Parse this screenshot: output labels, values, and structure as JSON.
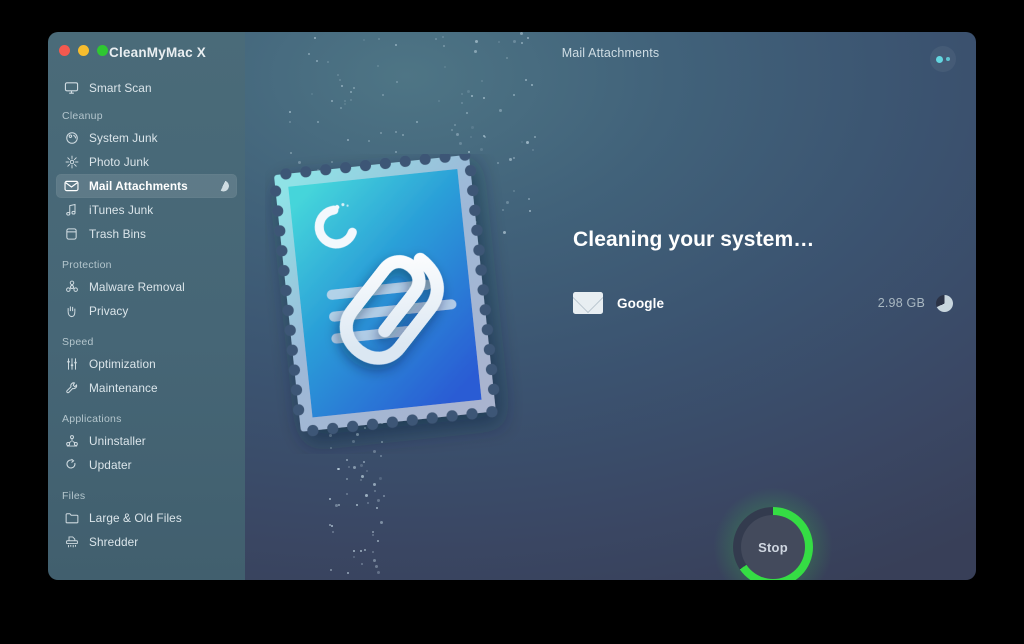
{
  "window": {
    "app_title": "CleanMyMac X",
    "window_title": "Mail Attachments",
    "traffic_lights": [
      "close",
      "minimize",
      "zoom"
    ]
  },
  "sidebar": {
    "top_items": [
      {
        "label": "Smart Scan",
        "icon": "smart-scan-icon"
      }
    ],
    "groups": [
      {
        "label": "Cleanup",
        "items": [
          {
            "label": "System Junk",
            "icon": "system-junk-icon",
            "selected": false
          },
          {
            "label": "Photo Junk",
            "icon": "photo-junk-icon",
            "selected": false
          },
          {
            "label": "Mail Attachments",
            "icon": "mail-icon",
            "selected": true,
            "busy": true
          },
          {
            "label": "iTunes Junk",
            "icon": "music-note-icon",
            "selected": false
          },
          {
            "label": "Trash Bins",
            "icon": "trash-bin-icon",
            "selected": false
          }
        ]
      },
      {
        "label": "Protection",
        "items": [
          {
            "label": "Malware Removal",
            "icon": "biohazard-icon",
            "selected": false
          },
          {
            "label": "Privacy",
            "icon": "hand-icon",
            "selected": false
          }
        ]
      },
      {
        "label": "Speed",
        "items": [
          {
            "label": "Optimization",
            "icon": "sliders-icon",
            "selected": false
          },
          {
            "label": "Maintenance",
            "icon": "wrench-icon",
            "selected": false
          }
        ]
      },
      {
        "label": "Applications",
        "items": [
          {
            "label": "Uninstaller",
            "icon": "uninstaller-icon",
            "selected": false
          },
          {
            "label": "Updater",
            "icon": "refresh-icon",
            "selected": false
          }
        ]
      },
      {
        "label": "Files",
        "items": [
          {
            "label": "Large & Old Files",
            "icon": "folder-icon",
            "selected": false
          },
          {
            "label": "Shredder",
            "icon": "shredder-icon",
            "selected": false
          }
        ]
      }
    ]
  },
  "main": {
    "headline": "Cleaning your system…",
    "items": [
      {
        "name": "Google",
        "size": "2.98 GB",
        "icon": "mail-envelope-icon",
        "progress_pct": 68
      }
    ],
    "illustration": "mail-stamp-with-paperclip",
    "stop_button": {
      "label": "Stop",
      "progress_pct": 65
    }
  },
  "colors": {
    "accent_green": "#35dd44",
    "sidebar_bg": "#466676",
    "content_bg": "#3b5370",
    "stamp_top": "#3fd0d9",
    "stamp_bottom": "#2a5fd0"
  }
}
